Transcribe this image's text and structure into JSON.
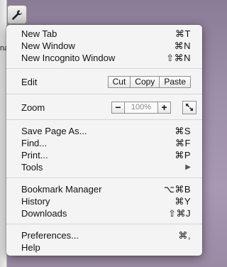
{
  "toolbar": {
    "left_tab_text": "na"
  },
  "menu": {
    "group1": [
      {
        "label": "New Tab",
        "shortcut": "⌘T"
      },
      {
        "label": "New Window",
        "shortcut": "⌘N"
      },
      {
        "label": "New Incognito Window",
        "shortcut": "⇧⌘N"
      }
    ],
    "edit": {
      "label": "Edit",
      "cut": "Cut",
      "copy": "Copy",
      "paste": "Paste"
    },
    "zoom": {
      "label": "Zoom",
      "minus": "−",
      "value": "100%",
      "plus": "+"
    },
    "group2": [
      {
        "label": "Save Page As...",
        "shortcut": "⌘S"
      },
      {
        "label": "Find...",
        "shortcut": "⌘F"
      },
      {
        "label": "Print...",
        "shortcut": "⌘P"
      },
      {
        "label": "Tools",
        "shortcut": "▶"
      }
    ],
    "group3": [
      {
        "label": "Bookmark Manager",
        "shortcut": "⌥⌘B"
      },
      {
        "label": "History",
        "shortcut": "⌘Y"
      },
      {
        "label": "Downloads",
        "shortcut": "⇧⌘J"
      }
    ],
    "group4": [
      {
        "label": "Preferences...",
        "shortcut": "⌘,"
      },
      {
        "label": "Help",
        "shortcut": ""
      }
    ]
  }
}
